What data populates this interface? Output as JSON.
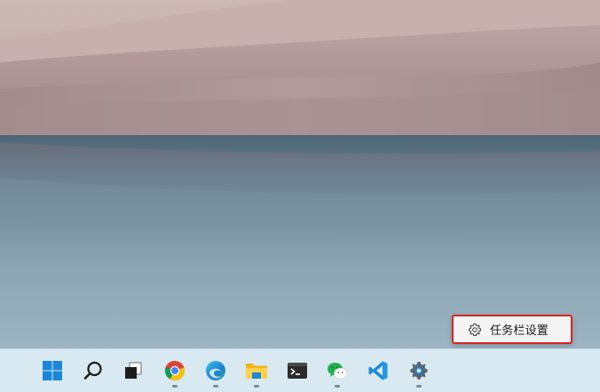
{
  "context_menu": {
    "items": [
      {
        "label": "任务栏设置",
        "icon": "gear-icon"
      }
    ]
  },
  "taskbar": {
    "apps": [
      {
        "name": "start",
        "icon": "windows-logo-icon",
        "running": false
      },
      {
        "name": "search",
        "icon": "search-icon",
        "running": false
      },
      {
        "name": "task-view",
        "icon": "task-view-icon",
        "running": false
      },
      {
        "name": "chrome",
        "icon": "chrome-icon",
        "running": true
      },
      {
        "name": "edge",
        "icon": "edge-icon",
        "running": true
      },
      {
        "name": "file-explorer",
        "icon": "folder-icon",
        "running": true
      },
      {
        "name": "terminal",
        "icon": "terminal-icon",
        "running": false
      },
      {
        "name": "wechat",
        "icon": "wechat-icon",
        "running": true
      },
      {
        "name": "vscode",
        "icon": "vscode-icon",
        "running": false
      },
      {
        "name": "settings",
        "icon": "gear-icon",
        "running": true
      }
    ]
  },
  "colors": {
    "highlight_border": "#d9251d",
    "taskbar_bg": "#d9e9f1",
    "windows_blue": "#1a86d9"
  }
}
